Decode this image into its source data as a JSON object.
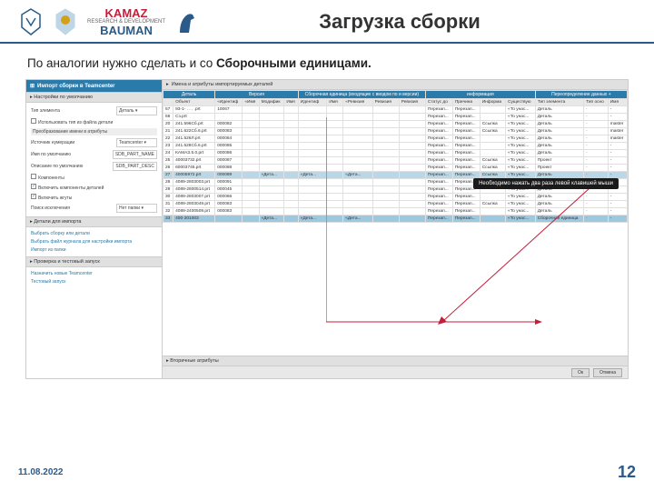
{
  "slide": {
    "title": "Загрузка сборки",
    "subtitle_pre": "По аналогии нужно сделать и со ",
    "subtitle_bold": "Сборочными единицами.",
    "date": "11.08.2022",
    "page": "12"
  },
  "logos": {
    "kamaz": "KAMAZ",
    "kamaz_sub": "RESEARCH & DEVELOPMENT",
    "bauman": "BAUMAN"
  },
  "app": {
    "window_title": "Импорт сборки в Teamcenter",
    "left": {
      "section1": "Настройки по умолчанию",
      "type_label": "Тип элемента",
      "type_value": "Деталь",
      "chk1": "Использовать тип из файла детали",
      "section_pref": "Преобразование имени в атрибуты",
      "src_label": "Источник нумерации",
      "src_value": "Teamcenter",
      "name_default_label": "Имя по умолчанию",
      "name_default_value": "SDB_PART_NAME",
      "desc_default_label": "Описание по умолчанию",
      "desc_default_value": "SDB_PART_DESC",
      "chk2": "Компоненты",
      "chk3": "Включить компоненты деталей",
      "chk4": "Включить жгуты",
      "exclude_label": "Поиск исключения",
      "exclude_value": "Нет папки",
      "section2": "Детали для импорта",
      "l2a": "Выбрать сборку или детали",
      "l2b": "Выбрать файл журнала для настройки импорта",
      "l2c": "Импорт из папки",
      "section3": "Проверка и тестовый запуск",
      "l3a": "Назначить новые Teamcenter",
      "l3b": "Тестовый запуск"
    },
    "main_header": "Имена и атрибуты импортируемых деталей",
    "tooltip": "Необходимо нажать два раза левой клавишей мыши",
    "group_headers": {
      "g1": "Деталь",
      "g2": "Версия",
      "g3": "Сборочная единица (входящие с вводом по и версии)",
      "g4": "информация",
      "g5": "Переопределение данных +"
    },
    "columns": [
      "",
      "Объект",
      "«Идентиф",
      "«Имя",
      "Модифик",
      "Имя",
      "Идентиф",
      "Имя",
      "«Ревизия",
      "Ревизия",
      "Ревизия",
      "Статус до",
      "Причина",
      "Информа",
      "Существую",
      "Тип элемента",
      "Тип осно",
      "Имя"
    ],
    "rows": [
      {
        "n": "57",
        "f": "93-1- . . . .prt",
        "id": "10067",
        "nm": "",
        "m": "",
        "nm2": "",
        "id2": "",
        "nm3": "",
        "r": "",
        "r2": "",
        "r3": "",
        "st": "Перезап...",
        "pr": "Перезап...",
        "inf": "",
        "ex": "«То унас...",
        "ty": "Деталь",
        "to": "·",
        "im": "-"
      },
      {
        "n": "58",
        "f": "Сз.prt",
        "id": "",
        "nm": "",
        "m": "",
        "nm2": "",
        "id2": "",
        "nm3": "",
        "r": "",
        "r2": "",
        "r3": "",
        "st": "Перезап...",
        "pr": "Перезап...",
        "inf": "",
        "ex": "«То унас...",
        "ty": "Деталь",
        "to": "·",
        "im": "-"
      },
      {
        "n": "20",
        "f": "241.596Сб.prt",
        "id": "000082",
        "nm": "",
        "m": "",
        "nm2": "",
        "id2": "",
        "nm3": "",
        "r": "",
        "r2": "",
        "r3": "",
        "st": "Перезап...",
        "pr": "Перезап...",
        "inf": "Ссылка",
        "ex": "«То унас...",
        "ty": "Деталь",
        "to": "·",
        "im": "master"
      },
      {
        "n": "21",
        "f": "241.622Сб.6.prt",
        "id": "000083",
        "nm": "",
        "m": "",
        "nm2": "",
        "id2": "",
        "nm3": "",
        "r": "",
        "r2": "",
        "r3": "",
        "st": "Перезап...",
        "pr": "Перезап...",
        "inf": "Ссылка",
        "ex": "«То унас...",
        "ty": "Деталь",
        "to": "·",
        "im": "master"
      },
      {
        "n": "22",
        "f": "241.526Л.prt",
        "id": "000084",
        "nm": "",
        "m": "",
        "nm2": "",
        "id2": "",
        "nm3": "",
        "r": "",
        "r2": "",
        "r3": "",
        "st": "Перезап...",
        "pr": "Перезап...",
        "inf": "",
        "ex": "«То унас...",
        "ty": "Деталь",
        "to": "·",
        "im": "master"
      },
      {
        "n": "23",
        "f": "241.528Сб.6.prt",
        "id": "000085",
        "nm": "",
        "m": "",
        "nm2": "",
        "id2": "",
        "nm3": "",
        "r": "",
        "r2": "",
        "r3": "",
        "st": "Перезап...",
        "pr": "Перезап...",
        "inf": "",
        "ex": "«То унас...",
        "ty": "Деталь",
        "to": "·",
        "im": "-"
      },
      {
        "n": "24",
        "f": "КАМАЗ.5.0.prt",
        "id": "000086",
        "nm": "",
        "m": "",
        "nm2": "",
        "id2": "",
        "nm3": "",
        "r": "",
        "r2": "",
        "r3": "",
        "st": "Перезап...",
        "pr": "Перезап...",
        "inf": "",
        "ex": "«То унас...",
        "ty": "Деталь",
        "to": "·",
        "im": "-"
      },
      {
        "n": "25",
        "f": "40003732.prt",
        "id": "000087",
        "nm": "",
        "m": "",
        "nm2": "",
        "id2": "",
        "nm3": "",
        "r": "",
        "r2": "",
        "r3": "",
        "st": "Перезап...",
        "pr": "Перезап...",
        "inf": "Ссылка",
        "ex": "«То унас...",
        "ty": "Проект",
        "to": "·",
        "im": "-"
      },
      {
        "n": "26",
        "f": "60003745.prt",
        "id": "000088",
        "nm": "",
        "m": "",
        "nm2": "",
        "id2": "",
        "nm3": "",
        "r": "",
        "r2": "",
        "r3": "",
        "st": "Перезап...",
        "pr": "Перезап...",
        "inf": "Ссылка",
        "ex": "«То унас...",
        "ty": "Проект",
        "to": "·",
        "im": "-"
      },
      {
        "n": "27",
        "f": "40005972.prt",
        "id": "000089",
        "nm": "",
        "m": "«Дета...",
        "nm2": "",
        "id2": "«Дета...",
        "nm3": "",
        "r": "«Дета...",
        "r2": "",
        "r3": "",
        "st": "Перезап...",
        "pr": "Перезап...",
        "inf": "Ссылка",
        "ex": "«То унас...",
        "ty": "Деталь",
        "to": "·",
        "im": "-",
        "hl": true
      },
      {
        "n": "28",
        "f": "4089-2803003.prt",
        "id": "000091",
        "nm": "",
        "m": "",
        "nm2": "",
        "id2": "",
        "nm3": "",
        "r": "",
        "r2": "",
        "r3": "",
        "st": "Перезап...",
        "pr": "Перезап...",
        "inf": "Ссылка",
        "ex": "«То унас...",
        "ty": "Деталь",
        "to": "·",
        "im": "-"
      },
      {
        "n": "29",
        "f": "4089-2800514.prt",
        "id": "000045",
        "nm": "",
        "m": "",
        "nm2": "",
        "id2": "",
        "nm3": "",
        "r": "",
        "r2": "",
        "r3": "",
        "st": "Перезап...",
        "pr": "Перезап...",
        "inf": "",
        "ex": "«То унас...",
        "ty": "Деталь",
        "to": "·",
        "im": "-"
      },
      {
        "n": "30",
        "f": "4089-2803007.prt",
        "id": "000066",
        "nm": "",
        "m": "",
        "nm2": "",
        "id2": "",
        "nm3": "",
        "r": "",
        "r2": "",
        "r3": "",
        "st": "Перезап...",
        "pr": "Перезап...",
        "inf": "",
        "ex": "«То унас...",
        "ty": "Деталь",
        "to": "·",
        "im": "-"
      },
      {
        "n": "31",
        "f": "4089-2803049.prt",
        "id": "000083",
        "nm": "",
        "m": "",
        "nm2": "",
        "id2": "",
        "nm3": "",
        "r": "",
        "r2": "",
        "r3": "",
        "st": "Перезап...",
        "pr": "Перезап...",
        "inf": "Ссылка",
        "ex": "«То унас...",
        "ty": "Деталь",
        "to": "·",
        "im": "-"
      },
      {
        "n": "32",
        "f": "4089-2400509.prt",
        "id": "000083",
        "nm": "",
        "m": "",
        "nm2": "",
        "id2": "",
        "nm3": "",
        "r": "",
        "r2": "",
        "r3": "",
        "st": "Перезап...",
        "pr": "Перезап...",
        "inf": "",
        "ex": "«То унас...",
        "ty": "Деталь",
        "to": "·",
        "im": "-"
      },
      {
        "n": "33",
        "f": "400·201003",
        "id": "",
        "nm": "",
        "m": "«Дета...",
        "nm2": "",
        "id2": "«Дета...",
        "nm3": "",
        "r": "«Дета...",
        "r2": "",
        "r3": "",
        "st": "Перезап...",
        "pr": "Перезап...",
        "inf": "",
        "ex": "«То унас...",
        "ty": "Сборочная единица",
        "to": "·",
        "im": "-",
        "hlf": true
      }
    ],
    "secondary": "Вторичные атрибуты",
    "ok": "Ок",
    "cancel": "Отмена"
  }
}
